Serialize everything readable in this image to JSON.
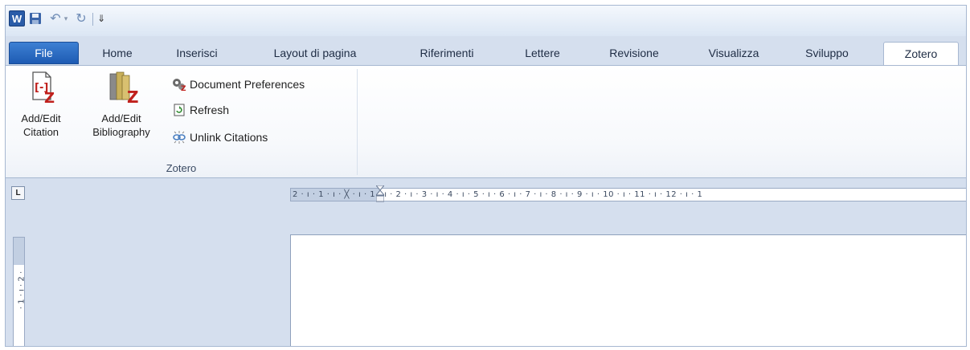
{
  "quick_access": {
    "app_icon_letter": "W",
    "undo_dropdown_glyph": "▾",
    "customize_glyph": "⇓"
  },
  "tabs": [
    {
      "label": "File"
    },
    {
      "label": "Home"
    },
    {
      "label": "Inserisci"
    },
    {
      "label": "Layout di pagina"
    },
    {
      "label": "Riferimenti"
    },
    {
      "label": "Lettere"
    },
    {
      "label": "Revisione"
    },
    {
      "label": "Visualizza"
    },
    {
      "label": "Sviluppo"
    },
    {
      "label": "Zotero"
    }
  ],
  "active_tab": "Zotero",
  "ribbon": {
    "add_edit_citation": {
      "line1": "Add/Edit",
      "line2": "Citation"
    },
    "add_edit_bibliography": {
      "line1": "Add/Edit",
      "line2": "Bibliography"
    },
    "document_preferences": "Document Preferences",
    "refresh": "Refresh",
    "unlink_citations": "Unlink Citations",
    "group_label": "Zotero"
  },
  "ruler": {
    "tab_selector_glyph": "L",
    "horizontal_text": "2 · ı · 1 · ı · ╳ · ı · 1 · ı · 2 · ı · 3 · ı · 4 · ı · 5 · ı · 6 · ı · 7 · ı · 8 · ı · 9 · ı · 10 · ı · 11 · ı · 12 · ı · 1",
    "vertical_text": "· 1 · ı · 2 ·"
  },
  "colors": {
    "file_tab": "#2b6bc2",
    "ribbon_bg": "#ffffff",
    "chrome_bg": "#d5dfee",
    "zotero_red": "#c0201c"
  }
}
